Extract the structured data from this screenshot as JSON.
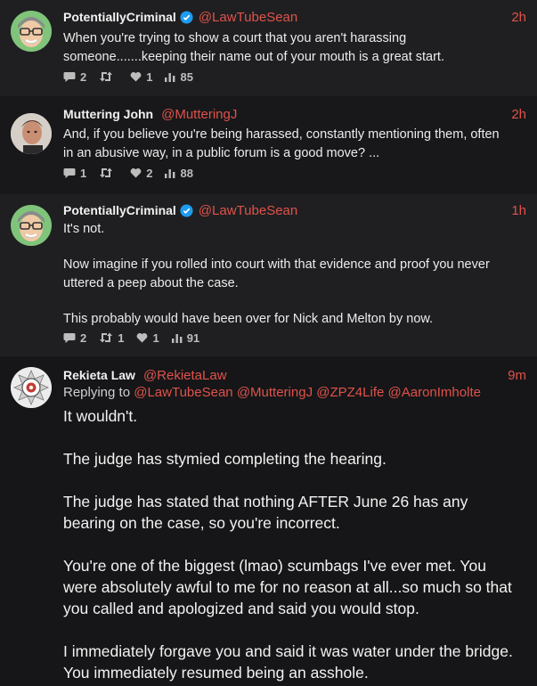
{
  "colors": {
    "accent": "#e0524a",
    "thread": "#a33a3a",
    "verified": "#1d9bf0"
  },
  "tweets": [
    {
      "name": "PotentiallyCriminal",
      "handle": "@LawTubeSean",
      "time": "2h",
      "verified": true,
      "lines": [
        "When you're trying to show a court that you aren't harassing",
        "someone.......keeping their name out of your mouth is a great start."
      ],
      "stats": {
        "replies": "2",
        "retweets": "",
        "likes": "1",
        "views": "85"
      }
    },
    {
      "name": "Muttering John",
      "handle": "@MutteringJ",
      "time": "2h",
      "verified": false,
      "lines": [
        "And, if you believe you're being harassed, constantly mentioning them, often",
        "in an abusive way, in a public forum is a good move? ..."
      ],
      "stats": {
        "replies": "1",
        "retweets": "",
        "likes": "2",
        "views": "88"
      }
    },
    {
      "name": "PotentiallyCriminal",
      "handle": "@LawTubeSean",
      "time": "1h",
      "verified": true,
      "paragraphs": [
        "It's not.",
        "Now imagine if you rolled into court with that evidence and proof you never",
        "uttered a peep about the case.",
        "This probably would have been over for Nick and Melton by now."
      ],
      "stats": {
        "replies": "2",
        "retweets": "1",
        "likes": "1",
        "views": "91"
      }
    },
    {
      "name": "Rekieta Law",
      "handle": "@RekietaLaw",
      "time": "9m",
      "verified": false,
      "replying_label": "Replying to",
      "replying_mentions": [
        "@LawTubeSean",
        "@MutteringJ",
        "@ZPZ4Life",
        "@AaronImholte"
      ],
      "lines": [
        "It wouldn't.",
        "The judge has stymied completing the hearing.",
        "The judge has stated that nothing AFTER June 26 has any",
        "bearing on the case, so you're incorrect.",
        "You're one of the biggest (lmao) scumbags I've ever met.  You",
        "were absolutely awful to me for no reason at all...so much so that",
        "you called and apologized and said you would stop.",
        "I immediately forgave you and said it was water under the bridge.",
        "You immediately resumed being an asshole."
      ]
    }
  ],
  "icons": {
    "reply": "reply-icon",
    "retweet": "retweet-icon",
    "like": "heart-icon",
    "views": "views-icon",
    "verified": "verified-badge-icon"
  }
}
